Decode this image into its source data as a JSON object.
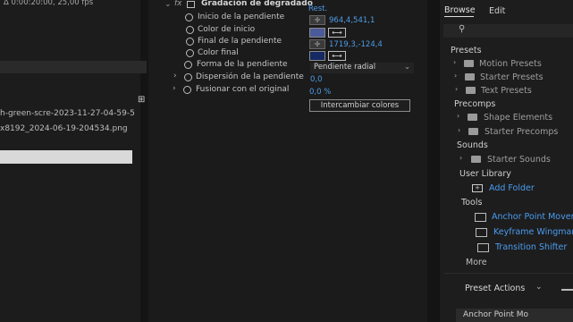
{
  "left": {
    "timecode": "Δ 0:00:20:00, 25,00 fps",
    "files": [
      "h-green-scre-2023-11-27-04-59-5",
      "x8192_2024-06-19-204534.png"
    ]
  },
  "effect": {
    "fx_label": "fx",
    "name": "Gradación de degradado",
    "reset": "Rest.",
    "props": [
      {
        "label": "Inicio de la pendiente",
        "value": "964,4,541,1"
      },
      {
        "label": "Color de inicio",
        "color": "#4b5a9a"
      },
      {
        "label": "Final de la pendiente",
        "value": "1719,3,-124,4"
      },
      {
        "label": "Color final",
        "color": "#152a63"
      },
      {
        "label": "Forma de la pendiente",
        "value": "Pendiente radial"
      },
      {
        "label": "Dispersión de la pendiente",
        "value": "0,0"
      },
      {
        "label": "Fusionar con el original",
        "value": "0,0 %"
      }
    ],
    "swap_button": "Intercambiar colores"
  },
  "right": {
    "tabs": [
      "Browse",
      "Edit"
    ],
    "sections": {
      "presets": "Presets",
      "precomps": "Precomps",
      "sounds": "Sounds",
      "user_library": "User Library",
      "tools": "Tools"
    },
    "preset_items": [
      "Motion Presets",
      "Starter Presets",
      "Text Presets"
    ],
    "precomp_items": [
      "Shape Elements",
      "Starter Precomps"
    ],
    "sound_items": [
      "Starter Sounds"
    ],
    "add_folder": "Add Folder",
    "tool_items": [
      "Anchor Point Mover",
      "Keyframe Wingman",
      "Transition Shifter"
    ],
    "more": "More",
    "preset_actions": "Preset Actions",
    "bottom_label": "Anchor Point Mo"
  }
}
